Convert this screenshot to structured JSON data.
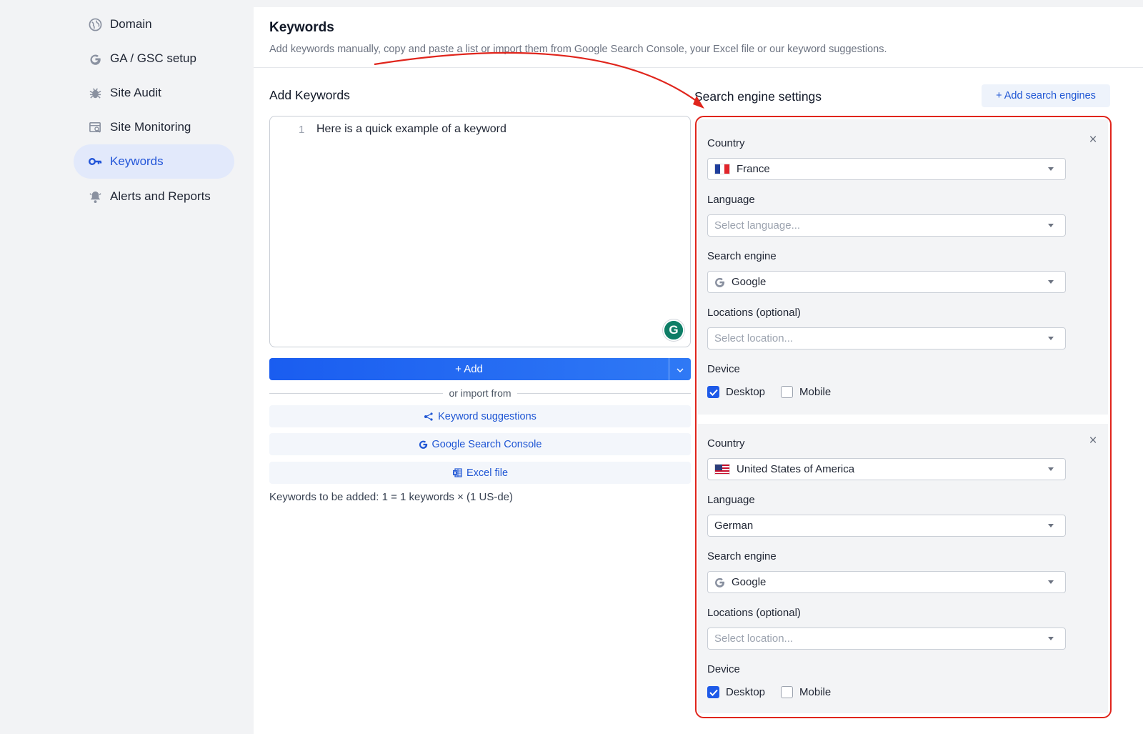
{
  "sidebar": {
    "items": [
      {
        "label": "Domain",
        "icon": "globe-icon"
      },
      {
        "label": "GA / GSC setup",
        "icon": "google-g-icon"
      },
      {
        "label": "Site Audit",
        "icon": "bug-icon"
      },
      {
        "label": "Site Monitoring",
        "icon": "monitor-search-icon"
      },
      {
        "label": "Keywords",
        "icon": "key-icon"
      },
      {
        "label": "Alerts and Reports",
        "icon": "bell-icon"
      }
    ],
    "active": "Keywords"
  },
  "header": {
    "title": "Keywords",
    "subtitle": "Add keywords manually, copy and paste a list or import them from Google Search Console, your Excel file or our keyword suggestions."
  },
  "add_keywords": {
    "title": "Add Keywords",
    "editor": {
      "line_number": "1",
      "text": "Here is a quick example of a keyword"
    },
    "add_button": "+ Add",
    "import_from": "or import from",
    "import_buttons": [
      "Keyword suggestions",
      "Google Search Console",
      "Excel file"
    ],
    "summary_prefix": "Keywords to be added: 1",
    "summary_suffix": " = 1 keywords × (1 US-de)"
  },
  "search_engine_settings": {
    "title": "Search engine settings",
    "add_button": "+ Add search engines",
    "labels": {
      "country": "Country",
      "language": "Language",
      "search_engine": "Search engine",
      "locations": "Locations (optional)",
      "device": "Device",
      "desktop": "Desktop",
      "mobile": "Mobile"
    },
    "cards": [
      {
        "country": "France",
        "language": "",
        "language_placeholder": "Select language...",
        "search_engine": "Google",
        "location_placeholder": "Select location...",
        "desktop": true,
        "mobile": false
      },
      {
        "country": "United States of America",
        "language": "German",
        "search_engine": "Google",
        "location_placeholder": "Select location...",
        "desktop": true,
        "mobile": false
      }
    ]
  },
  "colors": {
    "accent": "#1f56d4",
    "highlight_outline": "#e0251c",
    "active_nav_bg": "#e2e9fb"
  }
}
